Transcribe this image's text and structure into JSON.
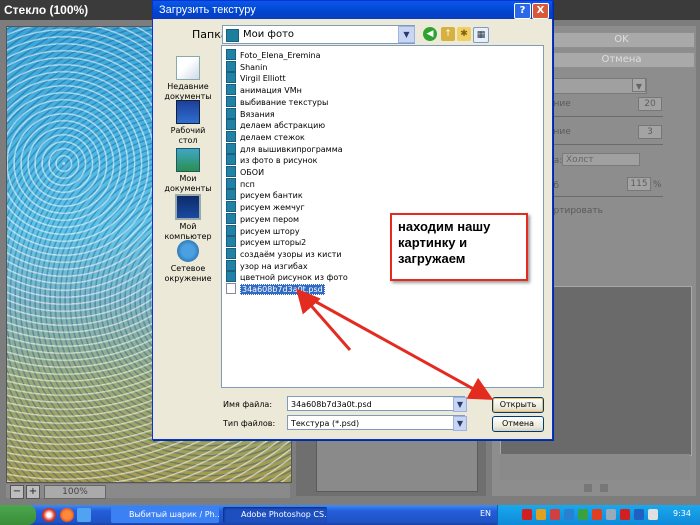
{
  "photoshop": {
    "window_title": "Стекло (100%)",
    "ok_label": "OK",
    "cancel_label": "Отмена",
    "zoom_value": "100%",
    "zoom_minus": "−",
    "zoom_plus": "+",
    "params": [
      {
        "label": "ение",
        "value": "20"
      },
      {
        "label": "ание",
        "value": "3"
      }
    ],
    "texture_label": "ра:",
    "texture_value": "Холст",
    "scale_label": "аб",
    "scale_value": "115",
    "scale_unit": "%",
    "invert_label": "ертировать"
  },
  "dialog": {
    "title": "Загрузить текстуру",
    "help_label": "?",
    "close_label": "X",
    "look_in_label": "Папка:",
    "look_in_value": "Мои фото",
    "places": [
      {
        "label": "Недавние документы"
      },
      {
        "label": "Рабочий стол"
      },
      {
        "label": "Мои документы"
      },
      {
        "label": "Мой компьютер"
      },
      {
        "label": "Сетевое окружение"
      }
    ],
    "files": [
      "Foto_Elena_Eremina",
      "Shanin",
      "Virgil Elliott",
      "анимация VMн",
      "выбивание текстуры",
      "Вязания",
      "делаем абстракцию",
      "делаем стежок",
      "для вышивкипрограмма",
      "из фото в рисунок",
      "ОБОИ",
      "псп",
      "рисуем бантик",
      "рисуем жемчуг",
      "рисуем пером",
      "рисуем штору",
      "рисуем шторы2",
      "создаём узоры из кисти",
      "узор на изгибах",
      "цветной рисунок из фото"
    ],
    "selected_file": "34a608b7d3a0t.psd",
    "file_name_label": "Имя файла:",
    "file_name_value": "34a608b7d3a0t.psd",
    "file_type_label": "Тип файлов:",
    "file_type_value": "Текстура (*.psd)",
    "open_label": "Открыть",
    "cancel_label": "Отмена"
  },
  "annotation": {
    "text": "находим нашу картинку и загружаем"
  },
  "taskbar": {
    "tasks": [
      {
        "label": "Выбитый шарик / Ph..."
      },
      {
        "label": "Adobe Photoshop CS..."
      }
    ],
    "language": "EN",
    "clock": "9:34"
  },
  "colors": {
    "dialog_title": "#0a58e8",
    "annotation_border": "#e32b20",
    "selection": "#316ac5",
    "taskbar": "#245edb"
  }
}
